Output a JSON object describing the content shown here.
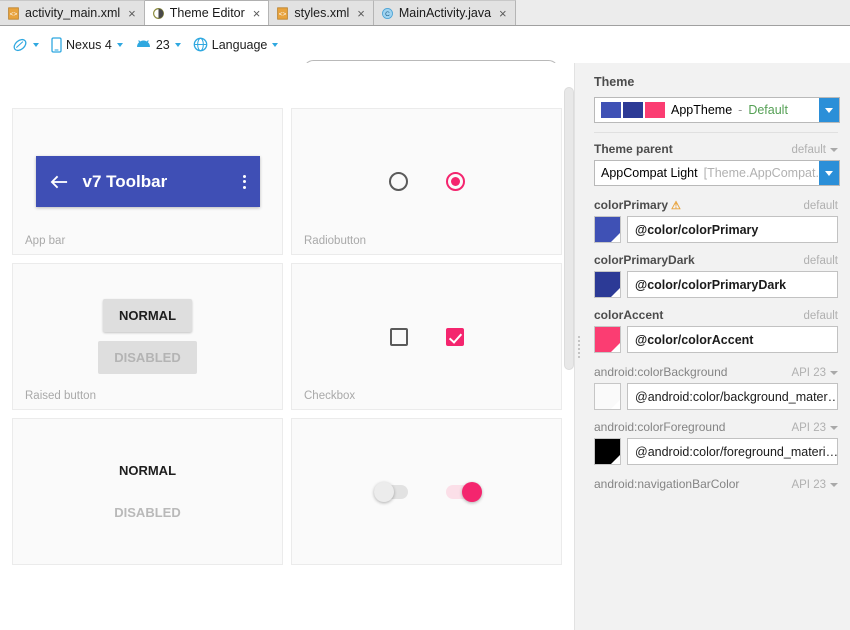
{
  "tabs": [
    {
      "label": "activity_main.xml",
      "icon": "xml-file-icon",
      "active": false,
      "close": "×"
    },
    {
      "label": "Theme Editor",
      "icon": "theme-editor-icon",
      "active": true,
      "close": "×"
    },
    {
      "label": "styles.xml",
      "icon": "xml-file-icon",
      "active": false,
      "close": "×"
    },
    {
      "label": "MainActivity.java",
      "icon": "java-file-icon",
      "active": false,
      "close": "×"
    }
  ],
  "toolbar": {
    "theme_selector_label": "",
    "device_label": "Nexus 4",
    "api_label": "23",
    "language_label": "Language",
    "search": {
      "value": "",
      "placeholder": ""
    }
  },
  "preview": {
    "cards": [
      {
        "label": "App bar",
        "kind": "appbar",
        "title": "v7 Toolbar"
      },
      {
        "label": "Radiobutton",
        "kind": "radio"
      },
      {
        "label": "Raised button",
        "kind": "raised",
        "normal": "NORMAL",
        "disabled": "DISABLED"
      },
      {
        "label": "Checkbox",
        "kind": "checkbox"
      },
      {
        "label": "",
        "kind": "flat",
        "normal": "NORMAL",
        "disabled": "DISABLED"
      },
      {
        "label": "",
        "kind": "switch"
      }
    ]
  },
  "panel": {
    "theme_section_title": "Theme",
    "theme_combo": {
      "name": "AppTheme",
      "separator": "-",
      "state": "Default",
      "swatches": [
        "#3f51b5",
        "#2c3a96",
        "#fb3d72"
      ]
    },
    "theme_parent_label": "Theme parent",
    "theme_parent_right": "default",
    "theme_parent_value": "AppCompat Light",
    "theme_parent_value_dim": "[Theme.AppCompat.Li",
    "attributes": [
      {
        "name": "colorPrimary",
        "warning": "⚠",
        "right": "default",
        "right_kind": "text",
        "swatch": "#3f51b5",
        "value": "@color/colorPrimary",
        "bold": true
      },
      {
        "name": "colorPrimaryDark",
        "right": "default",
        "right_kind": "text",
        "swatch": "#2c3a96",
        "value": "@color/colorPrimaryDark",
        "bold": true
      },
      {
        "name": "colorAccent",
        "right": "default",
        "right_kind": "text",
        "swatch": "#fb3d72",
        "value": "@color/colorAccent",
        "bold": true
      },
      {
        "name": "android:colorBackground",
        "right": "API 23",
        "right_kind": "dropdown",
        "swatch": "#fafafa",
        "value": "@android:color/background_mater…",
        "bold": false
      },
      {
        "name": "android:colorForeground",
        "right": "API 23",
        "right_kind": "dropdown",
        "swatch": "#000000",
        "value": "@android:color/foreground_materi…",
        "bold": false
      },
      {
        "name": "android:navigationBarColor",
        "right": "API 23",
        "right_kind": "dropdown",
        "swatch": null,
        "value": null,
        "bold": false
      }
    ]
  },
  "colors": {
    "primary": "#3f51b5",
    "primary_dark": "#2c3a96",
    "accent": "#fb3d72",
    "panel_bg": "#f2f2f2",
    "card_bg": "#fafafa"
  }
}
